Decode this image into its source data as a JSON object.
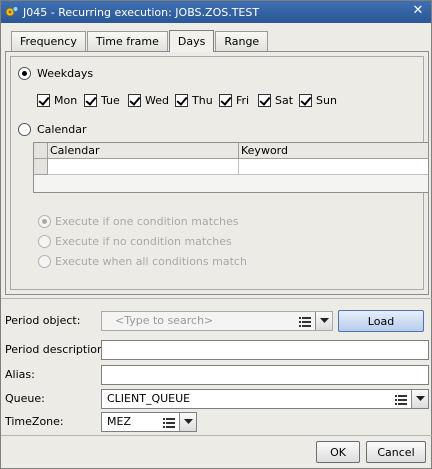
{
  "window": {
    "title": "J045 - Recurring execution: JOBS.ZOS.TEST",
    "title_icon": "gear-app-icon",
    "close_glyph": "✕"
  },
  "tabs": [
    {
      "label": "Frequency",
      "active": false
    },
    {
      "label": "Time frame",
      "active": false
    },
    {
      "label": "Days",
      "active": true
    },
    {
      "label": "Range",
      "active": false
    }
  ],
  "days_tab": {
    "weekdays_radio": {
      "label": "Weekdays",
      "checked": true
    },
    "weekdays": [
      {
        "label": "Mon",
        "checked": true
      },
      {
        "label": "Tue",
        "checked": true
      },
      {
        "label": "Wed",
        "checked": true
      },
      {
        "label": "Thu",
        "checked": true
      },
      {
        "label": "Fri",
        "checked": true
      },
      {
        "label": "Sat",
        "checked": true
      },
      {
        "label": "Sun",
        "checked": true
      }
    ],
    "calendar_radio": {
      "label": "Calendar",
      "checked": false
    },
    "calendar_table": {
      "columns": [
        "Calendar",
        "Keyword"
      ],
      "rows": [
        [
          "",
          ""
        ]
      ]
    },
    "conditions": [
      {
        "label": "Execute if one condition matches",
        "checked": true,
        "disabled": true
      },
      {
        "label": "Execute if no condition matches",
        "checked": false,
        "disabled": true
      },
      {
        "label": "Execute when all conditions match",
        "checked": false,
        "disabled": true
      }
    ]
  },
  "form": {
    "period_object": {
      "label": "Period object:",
      "placeholder": "<Type to search>",
      "value": ""
    },
    "load_button": "Load",
    "period_description": {
      "label": "Period description:",
      "value": ""
    },
    "alias": {
      "label": "Alias:",
      "value": ""
    },
    "queue": {
      "label": "Queue:",
      "value": "CLIENT_QUEUE"
    },
    "timezone": {
      "label": "TimeZone:",
      "value": "MEZ"
    }
  },
  "footer": {
    "ok": "OK",
    "cancel": "Cancel"
  },
  "colors": {
    "titlebar": "#2f5f9f",
    "dialog_bg": "#ecebe6",
    "load_button": "#b8ccea"
  }
}
